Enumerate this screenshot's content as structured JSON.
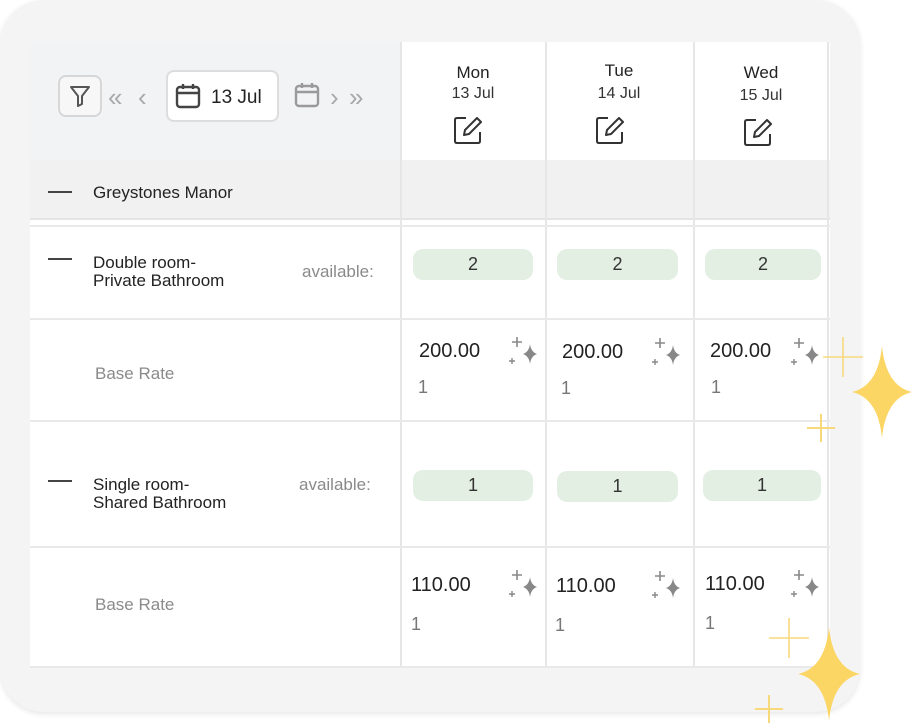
{
  "toolbar": {
    "current_date": "13 Jul"
  },
  "days": [
    {
      "name": "Mon",
      "date": "13 Jul"
    },
    {
      "name": "Tue",
      "date": "14 Jul"
    },
    {
      "name": "Wed",
      "date": "15 Jul"
    }
  ],
  "property": {
    "name": "Greystones Manor"
  },
  "rooms": [
    {
      "name_line1": "Double room-",
      "name_line2": "Private Bathroom",
      "available_label": "available:",
      "availability": [
        "2",
        "2",
        "2"
      ],
      "rate_label": "Base Rate",
      "rates": [
        "200.00",
        "200.00",
        "200.00"
      ],
      "rate_subs": [
        "1",
        "1",
        "1"
      ]
    },
    {
      "name_line1": "Single room-",
      "name_line2": "Shared Bathroom",
      "available_label": "available:",
      "availability": [
        "1",
        "1",
        "1"
      ],
      "rate_label": "Base Rate",
      "rates": [
        "110.00",
        "110.00",
        "110.00"
      ],
      "rate_subs": [
        "1",
        "1",
        "1"
      ]
    }
  ],
  "colors": {
    "pill_bg": "#e3efe3",
    "decor_star": "#fbd665",
    "decor_cross": "#f7d97c"
  }
}
